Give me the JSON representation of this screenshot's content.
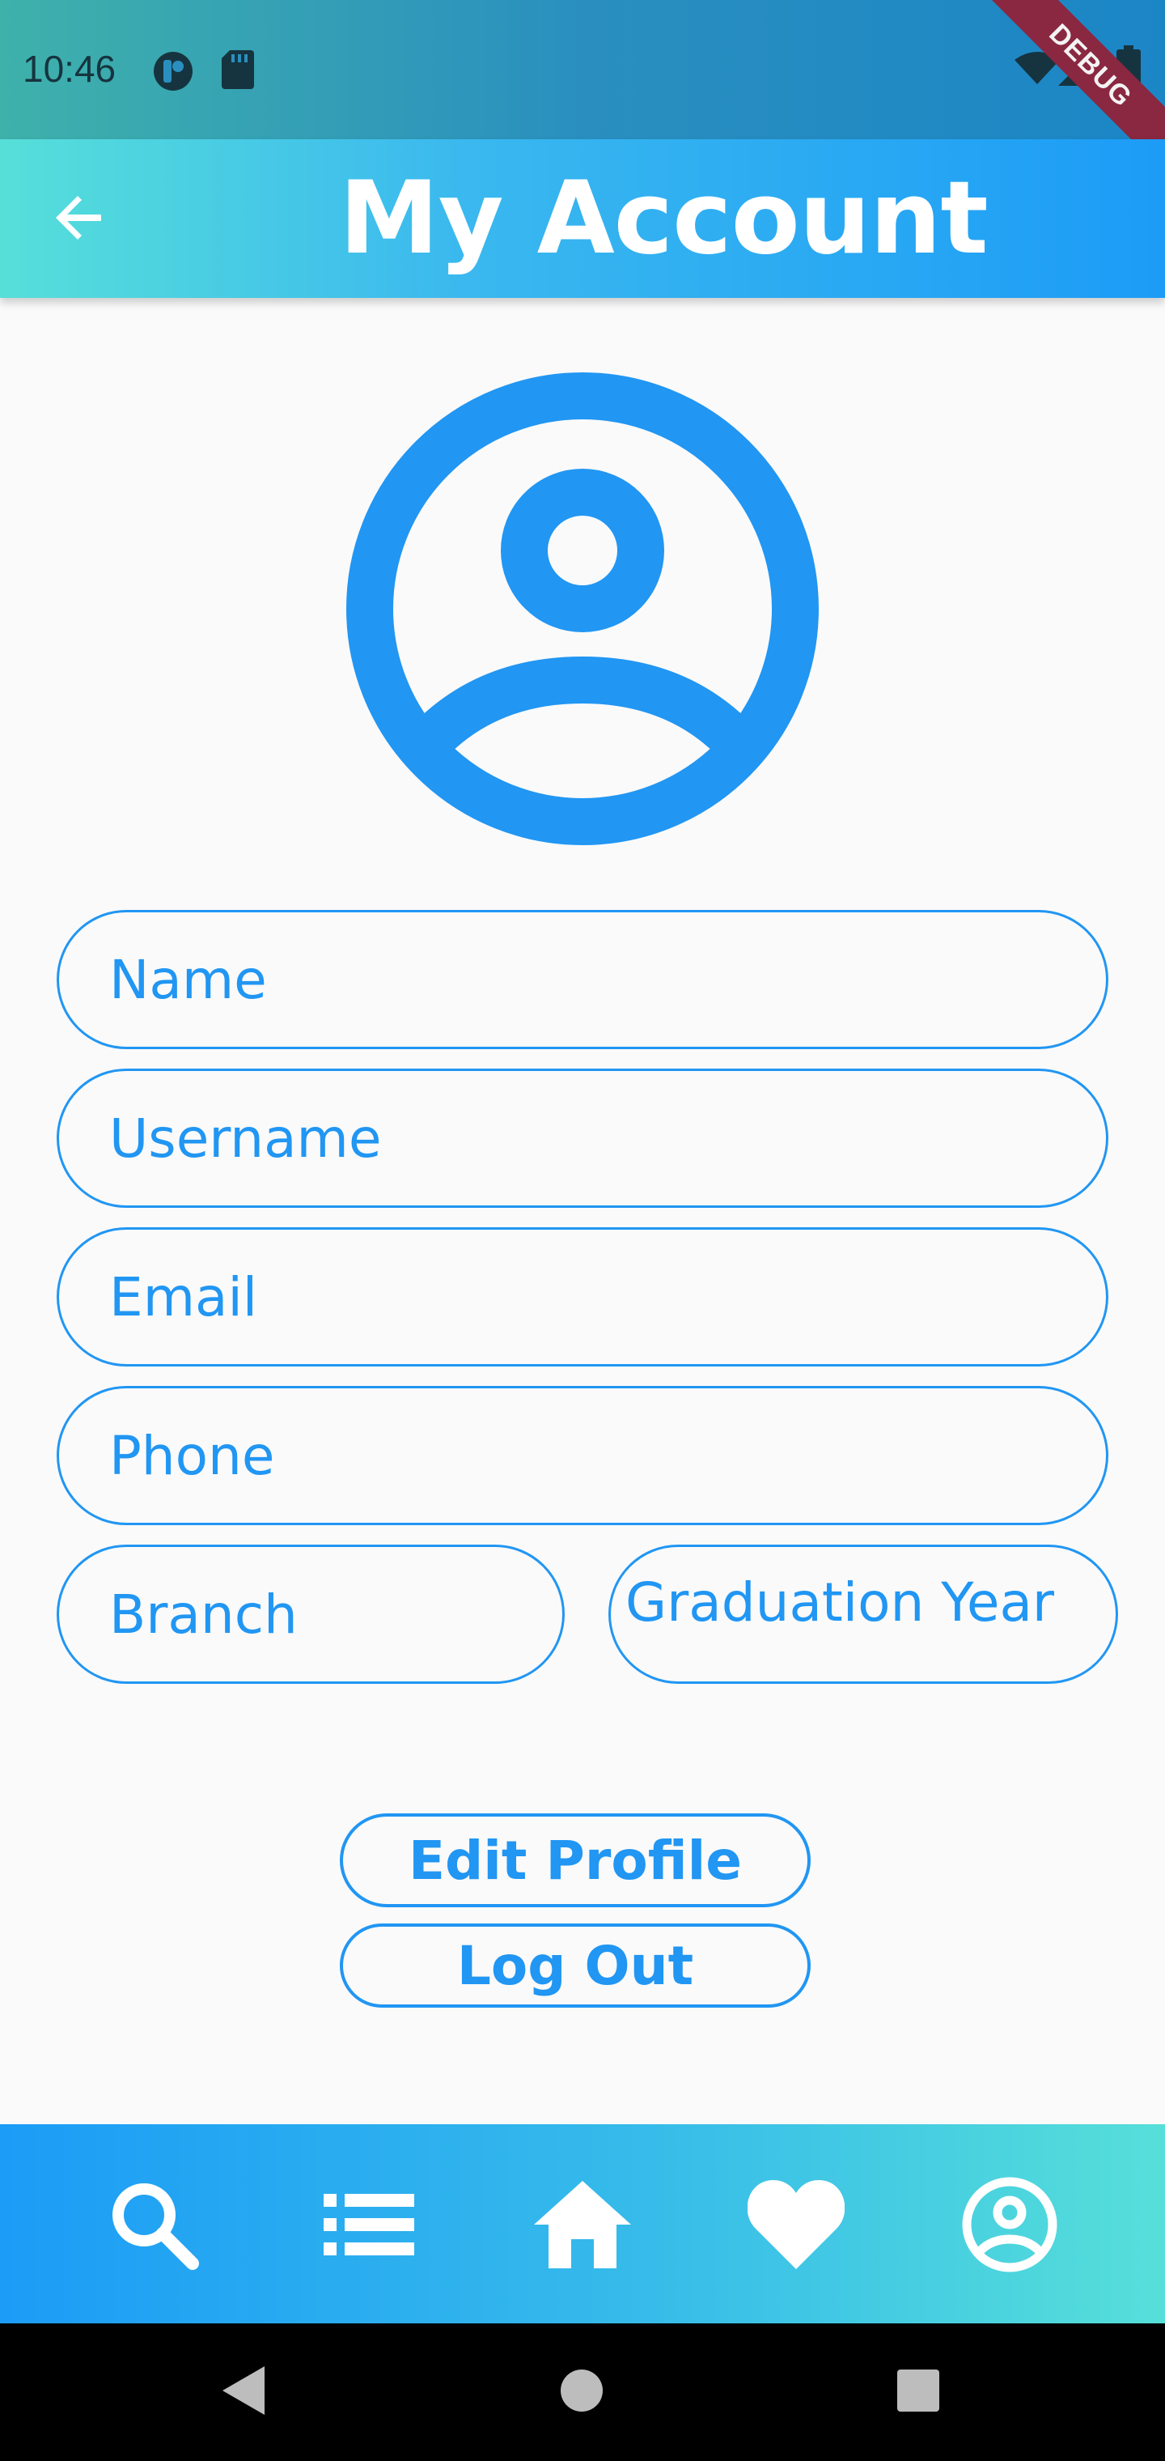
{
  "status_bar": {
    "time": "10:46",
    "debug_label": "DEBUG",
    "icons": [
      "circle-badge-icon",
      "sd-card-icon",
      "wifi-icon",
      "signal-icon",
      "battery-icon"
    ]
  },
  "app_bar": {
    "title": "My Account",
    "back_icon": "arrow-back-icon"
  },
  "avatar": {
    "icon": "account-circle-icon",
    "color": "#2196f3"
  },
  "form": {
    "fields": [
      {
        "label": "Name"
      },
      {
        "label": "Username"
      },
      {
        "label": "Email"
      },
      {
        "label": "Phone"
      },
      {
        "label": "Branch"
      },
      {
        "label": "Graduation Year"
      }
    ]
  },
  "actions": {
    "edit_profile_label": "Edit Profile",
    "log_out_label": "Log Out"
  },
  "bottom_nav": {
    "items": [
      {
        "icon": "search-icon"
      },
      {
        "icon": "list-icon"
      },
      {
        "icon": "home-icon"
      },
      {
        "icon": "heart-icon"
      },
      {
        "icon": "account-circle-icon"
      }
    ]
  },
  "system_nav": {
    "items": [
      "back-triangle-icon",
      "home-circle-icon",
      "recents-square-icon"
    ]
  },
  "colors": {
    "accent": "#2196f3",
    "gradient_start": "#56dfd9",
    "gradient_end": "#1c9cf6"
  }
}
